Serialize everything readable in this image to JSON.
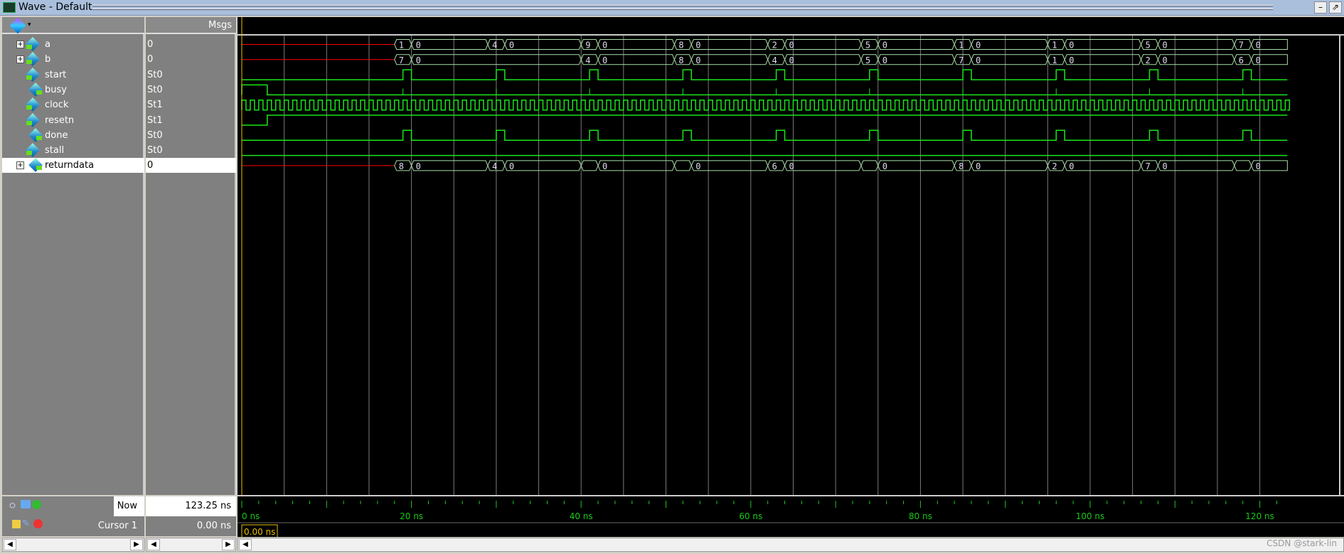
{
  "window": {
    "title": "Wave - Default",
    "icon": "wave-window-icon"
  },
  "header": {
    "msgs_label": "Msgs",
    "menu_icon": "wave-format-icon"
  },
  "signals": [
    {
      "name": "a",
      "value": "0",
      "kind": "bus",
      "expandable": true,
      "io": "in"
    },
    {
      "name": "b",
      "value": "0",
      "kind": "bus",
      "expandable": true,
      "io": "in"
    },
    {
      "name": "start",
      "value": "St0",
      "kind": "bit",
      "expandable": false,
      "io": "in"
    },
    {
      "name": "busy",
      "value": "St0",
      "kind": "bit",
      "expandable": false,
      "io": "out"
    },
    {
      "name": "clock",
      "value": "St1",
      "kind": "bit",
      "expandable": false,
      "io": "in"
    },
    {
      "name": "resetn",
      "value": "St1",
      "kind": "bit",
      "expandable": false,
      "io": "in"
    },
    {
      "name": "done",
      "value": "St0",
      "kind": "bit",
      "expandable": false,
      "io": "out"
    },
    {
      "name": "stall",
      "value": "St0",
      "kind": "bit",
      "expandable": false,
      "io": "in"
    },
    {
      "name": "returndata",
      "value": "0",
      "kind": "bus",
      "expandable": true,
      "io": "out",
      "selected": true
    }
  ],
  "waveforms": {
    "a": [
      [
        18,
        "1"
      ],
      [
        20,
        "0"
      ],
      [
        29,
        "4"
      ],
      [
        31,
        "0"
      ],
      [
        40,
        "9"
      ],
      [
        42,
        "0"
      ],
      [
        51,
        "8"
      ],
      [
        53,
        "0"
      ],
      [
        62,
        "2"
      ],
      [
        64,
        "0"
      ],
      [
        73,
        "5"
      ],
      [
        75,
        "0"
      ],
      [
        84,
        "1"
      ],
      [
        86,
        "0"
      ],
      [
        95,
        "1"
      ],
      [
        97,
        "0"
      ],
      [
        106,
        "5"
      ],
      [
        108,
        "0"
      ],
      [
        117,
        "7"
      ],
      [
        119,
        "0"
      ]
    ],
    "b": [
      [
        18,
        "7"
      ],
      [
        20,
        "0"
      ],
      [
        40,
        "4"
      ],
      [
        42,
        "0"
      ],
      [
        51,
        "8"
      ],
      [
        53,
        "0"
      ],
      [
        62,
        "4"
      ],
      [
        64,
        "0"
      ],
      [
        73,
        "5"
      ],
      [
        75,
        "0"
      ],
      [
        84,
        "7"
      ],
      [
        86,
        "0"
      ],
      [
        95,
        "1"
      ],
      [
        97,
        "0"
      ],
      [
        106,
        "2"
      ],
      [
        108,
        "0"
      ],
      [
        117,
        "6"
      ],
      [
        119,
        "0"
      ]
    ],
    "returndata": [
      [
        18,
        "8"
      ],
      [
        20,
        "0"
      ],
      [
        29,
        "4"
      ],
      [
        31,
        "0"
      ],
      [
        40,
        ""
      ],
      [
        42,
        "0"
      ],
      [
        51,
        ""
      ],
      [
        53,
        "0"
      ],
      [
        62,
        "6"
      ],
      [
        64,
        "0"
      ],
      [
        73,
        ""
      ],
      [
        75,
        "0"
      ],
      [
        84,
        "8"
      ],
      [
        86,
        "0"
      ],
      [
        95,
        "2"
      ],
      [
        97,
        "0"
      ],
      [
        106,
        "7"
      ],
      [
        108,
        "0"
      ],
      [
        117,
        ""
      ],
      [
        119,
        "0"
      ]
    ],
    "start": {
      "initial": 0,
      "pulses": [
        [
          19,
          20
        ],
        [
          30,
          31
        ],
        [
          41,
          42
        ],
        [
          52,
          53
        ],
        [
          63,
          64
        ],
        [
          74,
          75
        ],
        [
          85,
          86
        ],
        [
          96,
          97
        ],
        [
          107,
          108
        ],
        [
          118,
          119
        ]
      ]
    },
    "done": {
      "initial": 0,
      "pulses": [
        [
          19,
          20
        ],
        [
          30,
          31
        ],
        [
          41,
          42
        ],
        [
          52,
          53
        ],
        [
          63,
          64
        ],
        [
          74,
          75
        ],
        [
          85,
          86
        ],
        [
          96,
          97
        ],
        [
          107,
          108
        ],
        [
          118,
          119
        ]
      ]
    },
    "busy": {
      "initial": 1,
      "pulses": [
        [
          0,
          3
        ]
      ],
      "glitches": [
        19,
        30,
        41,
        52,
        63,
        74,
        85,
        96,
        107,
        118
      ]
    },
    "resetn": {
      "initial": 0,
      "rise": 3
    },
    "clock": {
      "period_ns": 1
    },
    "stall": {
      "initial": 0
    }
  },
  "timeline": {
    "now_label": "Now",
    "now_value": "123.25 ns",
    "cursor_label": "Cursor 1",
    "cursor_value": "0.00 ns",
    "cursor_time_label": "0.00 ns",
    "end_ns": 123.25,
    "ticks": [
      "0 ns",
      "20 ns",
      "40 ns",
      "60 ns",
      "80 ns",
      "100 ns",
      "120 ns"
    ],
    "tick_values": [
      0,
      20,
      40,
      60,
      80,
      100,
      120
    ]
  },
  "colors": {
    "wave": "#19e619",
    "bus": "#a8dca8",
    "unknown": "#ff0000",
    "grid": "#7a7a7a",
    "cursor": "#e8c000",
    "tick": "#19c819"
  },
  "watermark": "CSDN @stark-lin"
}
